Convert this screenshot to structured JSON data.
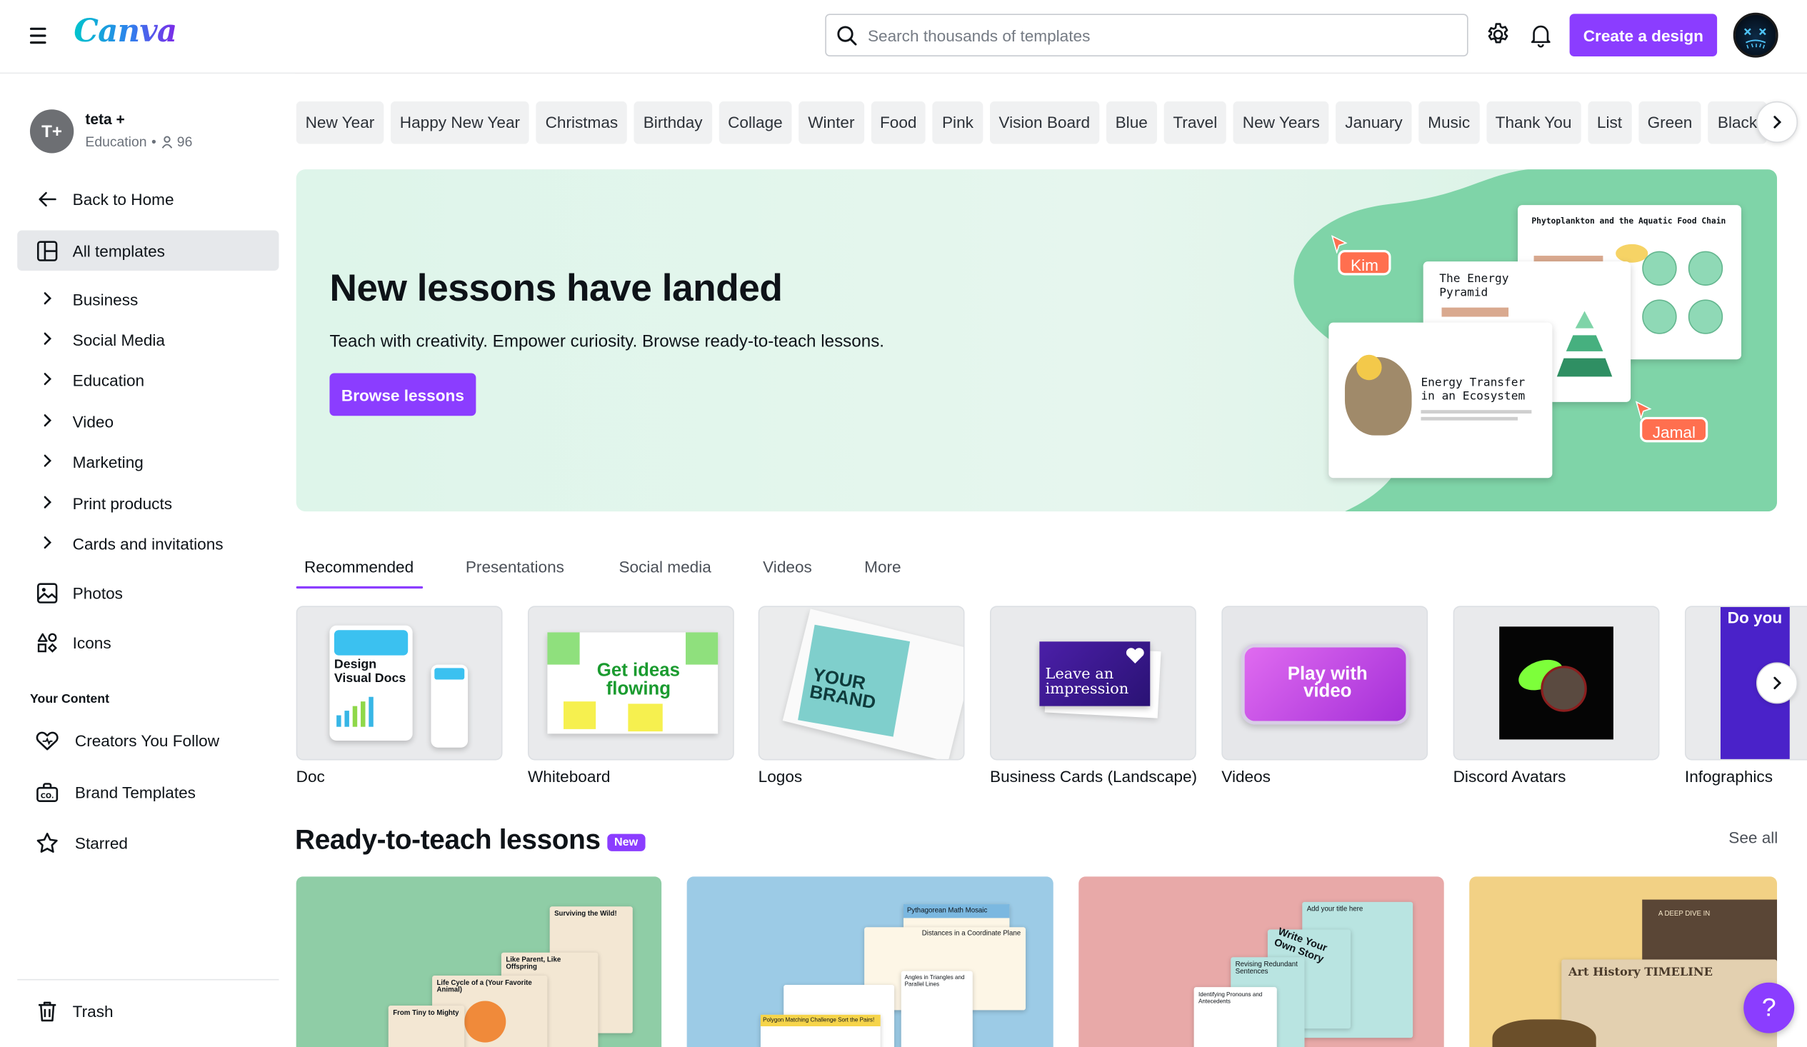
{
  "header": {
    "logo": "Canva",
    "search_placeholder": "Search thousands of templates",
    "create_button": "Create a design",
    "icons": [
      "menu-icon",
      "search-icon",
      "gear-icon",
      "bell-icon"
    ]
  },
  "sidebar": {
    "profile": {
      "initials": "T+",
      "name": "teta +",
      "plan": "Education",
      "members": "96"
    },
    "back_home": "Back to Home",
    "all_templates": "All templates",
    "categories": [
      "Business",
      "Social Media",
      "Education",
      "Video",
      "Marketing",
      "Print products",
      "Cards and invitations"
    ],
    "photos": "Photos",
    "icons": "Icons",
    "your_content_title": "Your Content",
    "creators": "Creators You Follow",
    "brand_templates": "Brand Templates",
    "starred": "Starred",
    "trash": "Trash"
  },
  "chips": [
    "New Year",
    "Happy New Year",
    "Christmas",
    "Birthday",
    "Collage",
    "Winter",
    "Food",
    "Pink",
    "Vision Board",
    "Blue",
    "Travel",
    "New Years",
    "January",
    "Music",
    "Thank You",
    "List",
    "Green",
    "Black"
  ],
  "banner": {
    "title": "New lessons have landed",
    "subtitle": "Teach with creativity. Empower curiosity. Browse ready-to-teach lessons.",
    "button": "Browse lessons",
    "slides": {
      "s1_title": "Phytoplankton and the Aquatic Food Chain",
      "s2_title": "The Energy Pyramid",
      "s3_title": "Energy Transfer in an Ecosystem"
    },
    "tag_kim": "Kim",
    "tag_jamal": "Jamal",
    "colors": {
      "bg": "#def5ea",
      "accent": "#7fd4a8",
      "tag": "#ff6f4f"
    }
  },
  "tabs": [
    "Recommended",
    "Presentations",
    "Social media",
    "Videos",
    "More"
  ],
  "design_types": [
    {
      "label": "Doc",
      "thumb_text": "Design Visual Docs"
    },
    {
      "label": "Whiteboard",
      "thumb_text": "Get ideas flowing"
    },
    {
      "label": "Logos",
      "thumb_text": "YOUR BRAND"
    },
    {
      "label": "Business Cards (Landscape)",
      "thumb_text": "Leave an impression"
    },
    {
      "label": "Videos",
      "thumb_text": "Play with video"
    },
    {
      "label": "Discord Avatars"
    },
    {
      "label": "Infographics",
      "thumb_text": "Do you"
    }
  ],
  "ready_to_teach": {
    "title": "Ready-to-teach lessons",
    "badge": "New",
    "see_all": "See all",
    "lessons": [
      {
        "bg": "#8fcda6",
        "texts": [
          "Surviving the Wild!",
          "Like Parent, Like Offspring",
          "Life Cycle of a (Your Favorite Animal)",
          "From Tiny to Mighty"
        ]
      },
      {
        "bg": "#9ccbe6",
        "texts": [
          "Pythagorean Math Mosaic",
          "Distances in a Coordinate Plane",
          "Angles in Triangles and Parallel Lines",
          "Polygon Matching Challenge Sort the Pairs!"
        ]
      },
      {
        "bg": "#e8a9a8",
        "texts": [
          "Add your title here",
          "Write Your Own Story",
          "Revising Redundant Sentences",
          "Identifying Pronouns and Antecedents"
        ]
      },
      {
        "bg": "#f2d185",
        "texts": [
          "A DEEP DIVE IN",
          "Art History TIMELINE"
        ]
      }
    ]
  },
  "help_label": "?"
}
